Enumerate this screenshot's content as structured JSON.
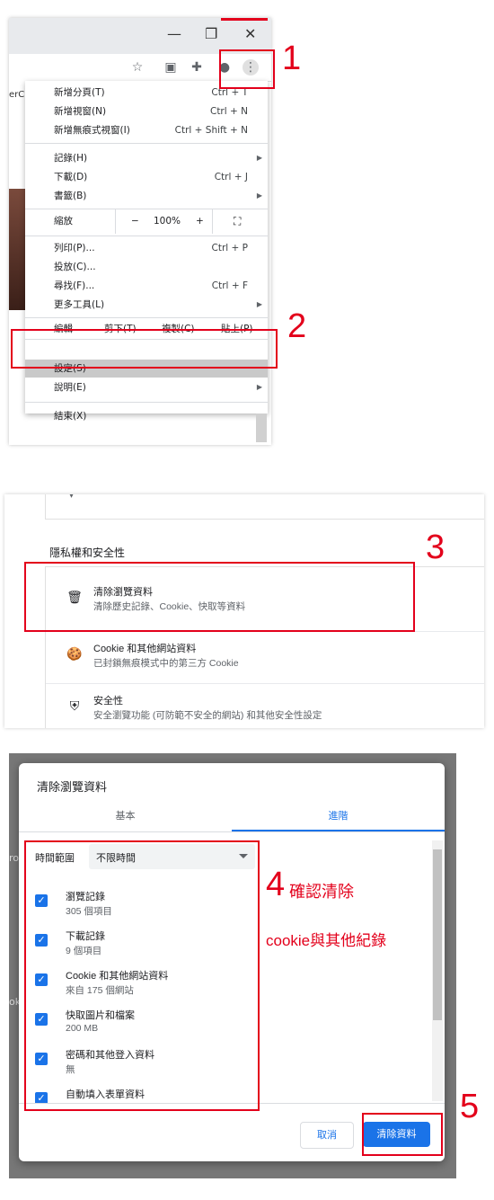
{
  "steps": [
    "1",
    "2",
    "3",
    "4",
    "5"
  ],
  "browser": {
    "window_controls": {
      "minimize": "—",
      "restore": "❐",
      "close": "✕"
    },
    "left_fragment": "erC",
    "menu": {
      "items": [
        {
          "label": "新增分頁(T)",
          "shortcut": "Ctrl + T"
        },
        {
          "label": "新增視窗(N)",
          "shortcut": "Ctrl + N"
        },
        {
          "label": "新增無痕式視窗(I)",
          "shortcut": "Ctrl + Shift + N"
        },
        {
          "label": "記錄(H)",
          "shortcut": ""
        },
        {
          "label": "下載(D)",
          "shortcut": "Ctrl + J"
        },
        {
          "label": "書籤(B)",
          "shortcut": ""
        },
        {
          "label": "列印(P)...",
          "shortcut": "Ctrl + P"
        },
        {
          "label": "投放(C)...",
          "shortcut": ""
        },
        {
          "label": "尋找(F)...",
          "shortcut": "Ctrl + F"
        },
        {
          "label": "更多工具(L)",
          "shortcut": ""
        },
        {
          "label": "設定(S)",
          "shortcut": ""
        },
        {
          "label": "說明(E)",
          "shortcut": ""
        },
        {
          "label": "結束(X)",
          "shortcut": ""
        }
      ],
      "zoom": {
        "label": "縮放",
        "minus": "−",
        "value": "100%",
        "plus": "+"
      },
      "edit": {
        "label": "編輯",
        "cut": "剪下(T)",
        "copy": "複製(C)",
        "paste": "貼上(P)"
      }
    }
  },
  "settings": {
    "section_title": "隱私權和安全性",
    "rows": [
      {
        "title": "清除瀏覽資料",
        "subtitle": "清除歷史記錄、Cookie、快取等資料"
      },
      {
        "title": "Cookie 和其他網站資料",
        "subtitle": "已封鎖無痕模式中的第三方 Cookie"
      },
      {
        "title": "安全性",
        "subtitle": "安全瀏覽功能 (可防範不安全的網站) 和其他安全性設定"
      }
    ]
  },
  "dialog": {
    "title": "清除瀏覽資料",
    "tabs": [
      "基本",
      "進階"
    ],
    "time_range_label": "時間範圍",
    "time_range_value": "不限時間",
    "options": [
      {
        "title": "瀏覽記錄",
        "detail": "305 個項目",
        "checked": true
      },
      {
        "title": "下載記錄",
        "detail": "9 個項目",
        "checked": true
      },
      {
        "title": "Cookie 和其他網站資料",
        "detail": "來自 175 個網站",
        "checked": true
      },
      {
        "title": "快取圖片和檔案",
        "detail": "200 MB",
        "checked": true
      },
      {
        "title": "密碼和其他登入資料",
        "detail": "無",
        "checked": true
      },
      {
        "title": "自動填入表單資料",
        "detail": "",
        "checked": true
      }
    ],
    "cancel": "取消",
    "confirm": "清除資料"
  },
  "annotations": {
    "note_line1": "確認清除",
    "note_line2": "cookie與其他紀錄"
  }
}
